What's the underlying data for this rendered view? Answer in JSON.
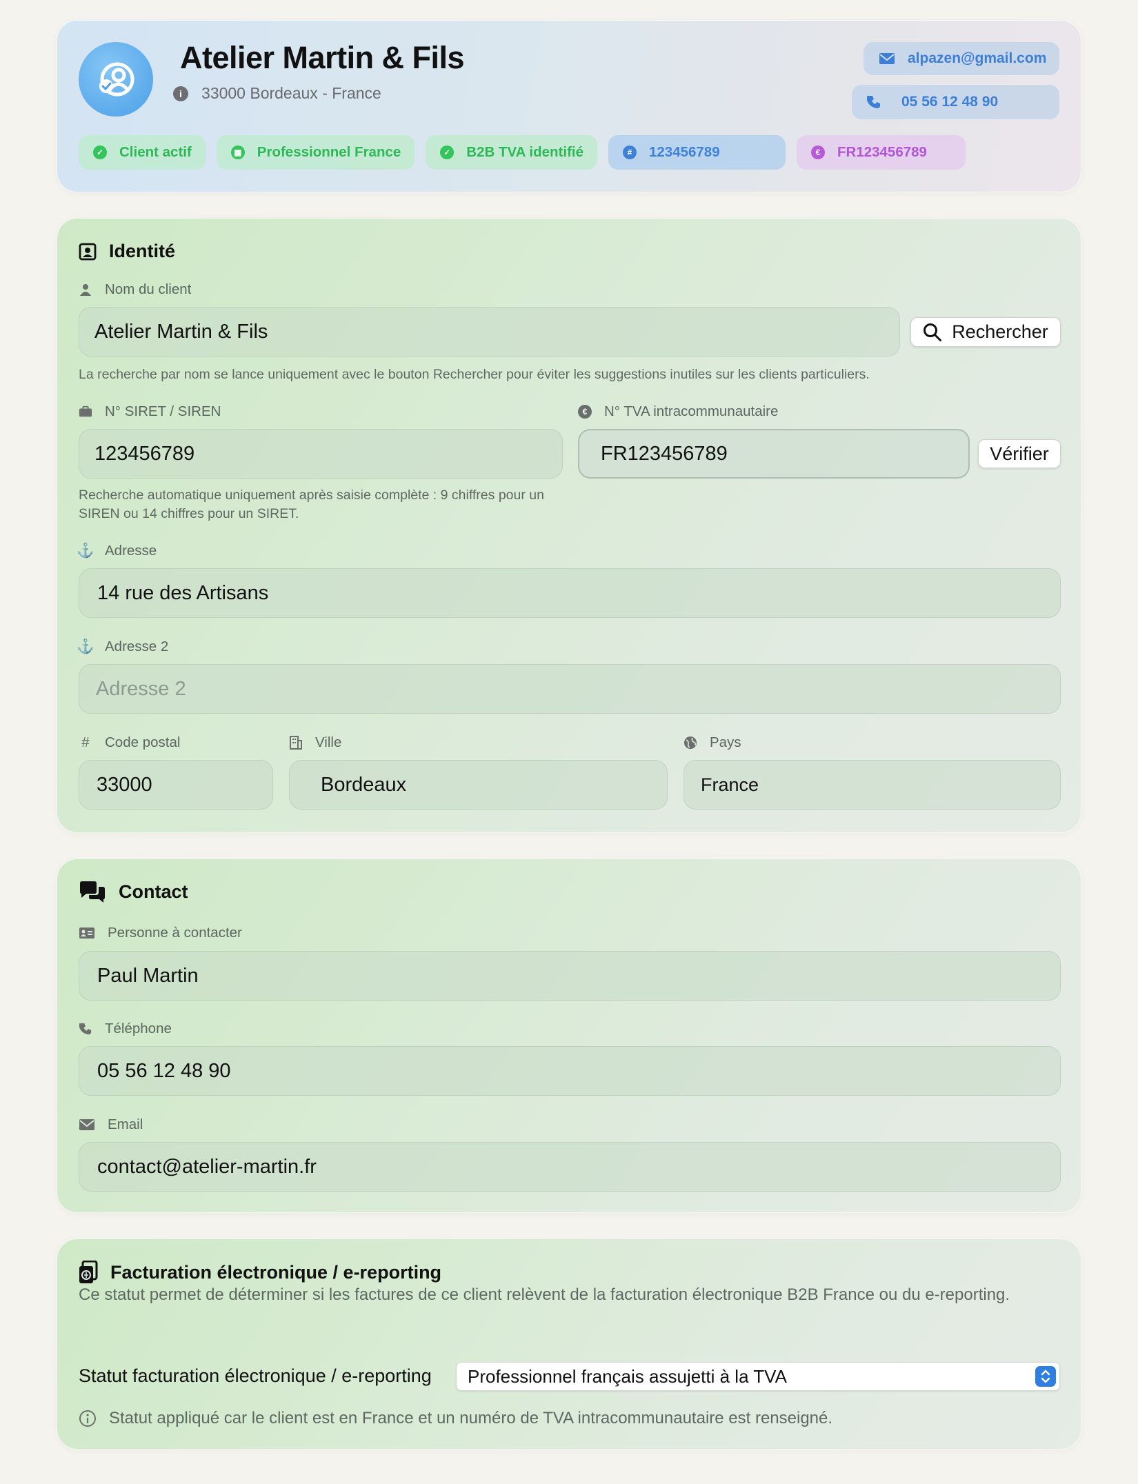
{
  "header": {
    "title": "Atelier Martin & Fils",
    "location": "33000 Bordeaux - France",
    "email": "alpazen@gmail.com",
    "phone": "05 56 12 48 90",
    "badges": [
      {
        "label": "Client actif",
        "color": "#2db856"
      },
      {
        "label": "Professionnel France",
        "color": "#2db856"
      },
      {
        "label": "B2B TVA identifié",
        "color": "#2db856"
      },
      {
        "label": "123456789",
        "color": "#3e82d8"
      },
      {
        "label": "FR123456789",
        "color": "#b255d6"
      }
    ]
  },
  "identite": {
    "title": "Identité",
    "nom_label": "Nom du client",
    "nom_value": "Atelier Martin & Fils",
    "search_button": "Rechercher",
    "nom_help": "La recherche par nom se lance uniquement avec le bouton Rechercher pour éviter les suggestions inutiles sur les clients particuliers.",
    "siret_label": "N° SIRET / SIREN",
    "siret_value": "123456789",
    "siret_help": "Recherche automatique uniquement après saisie complète : 9 chiffres pour un SIREN ou 14 chiffres pour un SIRET.",
    "tva_label": "N° TVA intracommunautaire",
    "tva_value": "FR123456789",
    "verify_button": "Vérifier",
    "adresse_label": "Adresse",
    "adresse_value": "14 rue des Artisans",
    "adresse2_label": "Adresse 2",
    "adresse2_placeholder": "Adresse 2",
    "cp_label": "Code postal",
    "cp_value": "33000",
    "ville_label": "Ville",
    "ville_value": "Bordeaux",
    "pays_label": "Pays",
    "pays_value": "France"
  },
  "contact": {
    "title": "Contact",
    "personne_label": "Personne à contacter",
    "personne_value": "Paul Martin",
    "tel_label": "Téléphone",
    "tel_value": "05 56 12 48 90",
    "email_label": "Email",
    "email_value": "contact@atelier-martin.fr"
  },
  "facturation": {
    "title": "Facturation électronique / e-reporting",
    "description": "Ce statut permet de déterminer si les factures de ce client relèvent de la facturation électronique B2B France ou du e-reporting.",
    "select_label": "Statut facturation électronique / e-reporting",
    "select_value": "Professionnel français assujetti à la TVA",
    "info": "Statut appliqué car le client est en France et un numéro de TVA intracommunautaire est renseigné."
  },
  "icons": {
    "avatar": "user-check-icon",
    "location": "info-icon",
    "email": "envelope-icon",
    "phone": "phone-icon"
  }
}
